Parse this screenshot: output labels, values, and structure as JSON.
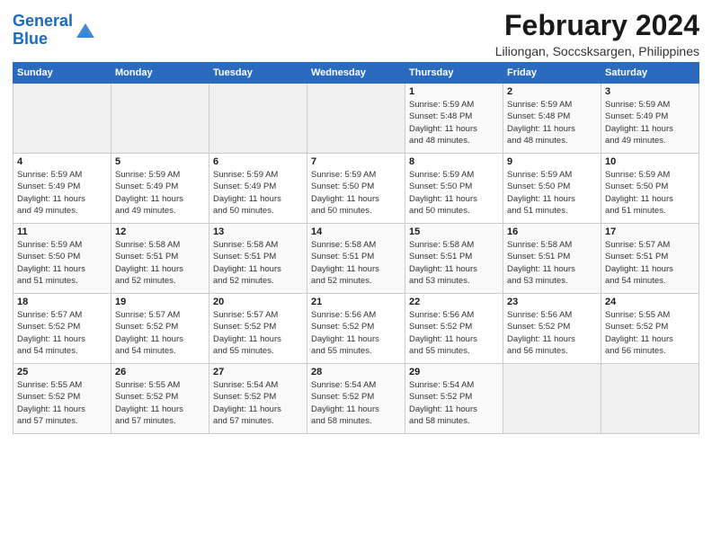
{
  "logo": {
    "line1": "General",
    "line2": "Blue"
  },
  "title": "February 2024",
  "subtitle": "Liliongan, Soccsksargen, Philippines",
  "headers": [
    "Sunday",
    "Monday",
    "Tuesday",
    "Wednesday",
    "Thursday",
    "Friday",
    "Saturday"
  ],
  "weeks": [
    [
      {
        "day": "",
        "info": ""
      },
      {
        "day": "",
        "info": ""
      },
      {
        "day": "",
        "info": ""
      },
      {
        "day": "",
        "info": ""
      },
      {
        "day": "1",
        "info": "Sunrise: 5:59 AM\nSunset: 5:48 PM\nDaylight: 11 hours\nand 48 minutes."
      },
      {
        "day": "2",
        "info": "Sunrise: 5:59 AM\nSunset: 5:48 PM\nDaylight: 11 hours\nand 48 minutes."
      },
      {
        "day": "3",
        "info": "Sunrise: 5:59 AM\nSunset: 5:49 PM\nDaylight: 11 hours\nand 49 minutes."
      }
    ],
    [
      {
        "day": "4",
        "info": "Sunrise: 5:59 AM\nSunset: 5:49 PM\nDaylight: 11 hours\nand 49 minutes."
      },
      {
        "day": "5",
        "info": "Sunrise: 5:59 AM\nSunset: 5:49 PM\nDaylight: 11 hours\nand 49 minutes."
      },
      {
        "day": "6",
        "info": "Sunrise: 5:59 AM\nSunset: 5:49 PM\nDaylight: 11 hours\nand 50 minutes."
      },
      {
        "day": "7",
        "info": "Sunrise: 5:59 AM\nSunset: 5:50 PM\nDaylight: 11 hours\nand 50 minutes."
      },
      {
        "day": "8",
        "info": "Sunrise: 5:59 AM\nSunset: 5:50 PM\nDaylight: 11 hours\nand 50 minutes."
      },
      {
        "day": "9",
        "info": "Sunrise: 5:59 AM\nSunset: 5:50 PM\nDaylight: 11 hours\nand 51 minutes."
      },
      {
        "day": "10",
        "info": "Sunrise: 5:59 AM\nSunset: 5:50 PM\nDaylight: 11 hours\nand 51 minutes."
      }
    ],
    [
      {
        "day": "11",
        "info": "Sunrise: 5:59 AM\nSunset: 5:50 PM\nDaylight: 11 hours\nand 51 minutes."
      },
      {
        "day": "12",
        "info": "Sunrise: 5:58 AM\nSunset: 5:51 PM\nDaylight: 11 hours\nand 52 minutes."
      },
      {
        "day": "13",
        "info": "Sunrise: 5:58 AM\nSunset: 5:51 PM\nDaylight: 11 hours\nand 52 minutes."
      },
      {
        "day": "14",
        "info": "Sunrise: 5:58 AM\nSunset: 5:51 PM\nDaylight: 11 hours\nand 52 minutes."
      },
      {
        "day": "15",
        "info": "Sunrise: 5:58 AM\nSunset: 5:51 PM\nDaylight: 11 hours\nand 53 minutes."
      },
      {
        "day": "16",
        "info": "Sunrise: 5:58 AM\nSunset: 5:51 PM\nDaylight: 11 hours\nand 53 minutes."
      },
      {
        "day": "17",
        "info": "Sunrise: 5:57 AM\nSunset: 5:51 PM\nDaylight: 11 hours\nand 54 minutes."
      }
    ],
    [
      {
        "day": "18",
        "info": "Sunrise: 5:57 AM\nSunset: 5:52 PM\nDaylight: 11 hours\nand 54 minutes."
      },
      {
        "day": "19",
        "info": "Sunrise: 5:57 AM\nSunset: 5:52 PM\nDaylight: 11 hours\nand 54 minutes."
      },
      {
        "day": "20",
        "info": "Sunrise: 5:57 AM\nSunset: 5:52 PM\nDaylight: 11 hours\nand 55 minutes."
      },
      {
        "day": "21",
        "info": "Sunrise: 5:56 AM\nSunset: 5:52 PM\nDaylight: 11 hours\nand 55 minutes."
      },
      {
        "day": "22",
        "info": "Sunrise: 5:56 AM\nSunset: 5:52 PM\nDaylight: 11 hours\nand 55 minutes."
      },
      {
        "day": "23",
        "info": "Sunrise: 5:56 AM\nSunset: 5:52 PM\nDaylight: 11 hours\nand 56 minutes."
      },
      {
        "day": "24",
        "info": "Sunrise: 5:55 AM\nSunset: 5:52 PM\nDaylight: 11 hours\nand 56 minutes."
      }
    ],
    [
      {
        "day": "25",
        "info": "Sunrise: 5:55 AM\nSunset: 5:52 PM\nDaylight: 11 hours\nand 57 minutes."
      },
      {
        "day": "26",
        "info": "Sunrise: 5:55 AM\nSunset: 5:52 PM\nDaylight: 11 hours\nand 57 minutes."
      },
      {
        "day": "27",
        "info": "Sunrise: 5:54 AM\nSunset: 5:52 PM\nDaylight: 11 hours\nand 57 minutes."
      },
      {
        "day": "28",
        "info": "Sunrise: 5:54 AM\nSunset: 5:52 PM\nDaylight: 11 hours\nand 58 minutes."
      },
      {
        "day": "29",
        "info": "Sunrise: 5:54 AM\nSunset: 5:52 PM\nDaylight: 11 hours\nand 58 minutes."
      },
      {
        "day": "",
        "info": ""
      },
      {
        "day": "",
        "info": ""
      }
    ]
  ]
}
